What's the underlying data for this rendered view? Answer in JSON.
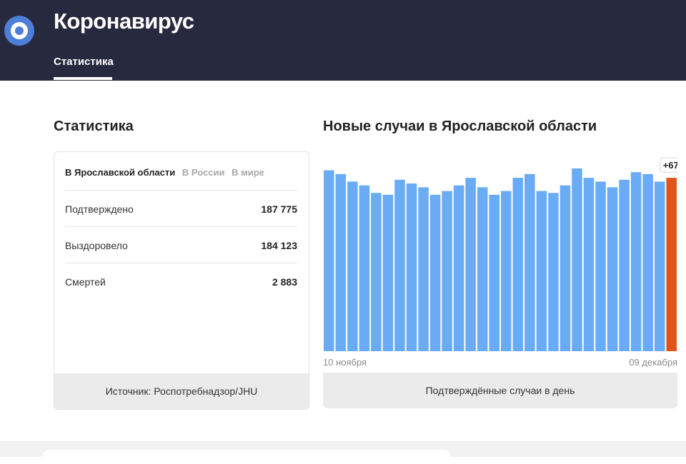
{
  "header": {
    "app_title": "Коронавирус",
    "tabs": [
      {
        "label": "Статистика",
        "active": true
      }
    ]
  },
  "statistics": {
    "title": "Статистика",
    "region_tabs": [
      {
        "label": "В Ярославской области",
        "active": true
      },
      {
        "label": "В России",
        "active": false
      },
      {
        "label": "В мире",
        "active": false
      }
    ],
    "rows": [
      {
        "label": "Подтверждено",
        "value": "187 775"
      },
      {
        "label": "Выздоровело",
        "value": "184 123"
      },
      {
        "label": "Смертей",
        "value": "2 883"
      }
    ],
    "source": "Источник: Роспотребнадзор/JHU"
  },
  "chart_section": {
    "title": "Новые случаи в Ярославской области",
    "footer": "Подтверждённые случаи в день"
  },
  "chart_data": {
    "type": "bar",
    "title": "Новые случаи в Ярославской области",
    "xlabel": "Подтверждённые случаи в день",
    "ylabel": "",
    "x_tick_labels": [
      "10 ноября",
      "09 декабря"
    ],
    "values": [
      96,
      94,
      90,
      88,
      84,
      83,
      91,
      89,
      87,
      83,
      85,
      88,
      92,
      87,
      83,
      85,
      92,
      94,
      85,
      84,
      88,
      97,
      92,
      90,
      87,
      91,
      95,
      94,
      90,
      92
    ],
    "highlight_last_label": "+67",
    "grid": false,
    "colors": {
      "bar": "#6aabf6",
      "highlight": "#e2531a"
    }
  },
  "colors": {
    "header_bg": "#272a3f",
    "accent": "#4e7fd8"
  }
}
